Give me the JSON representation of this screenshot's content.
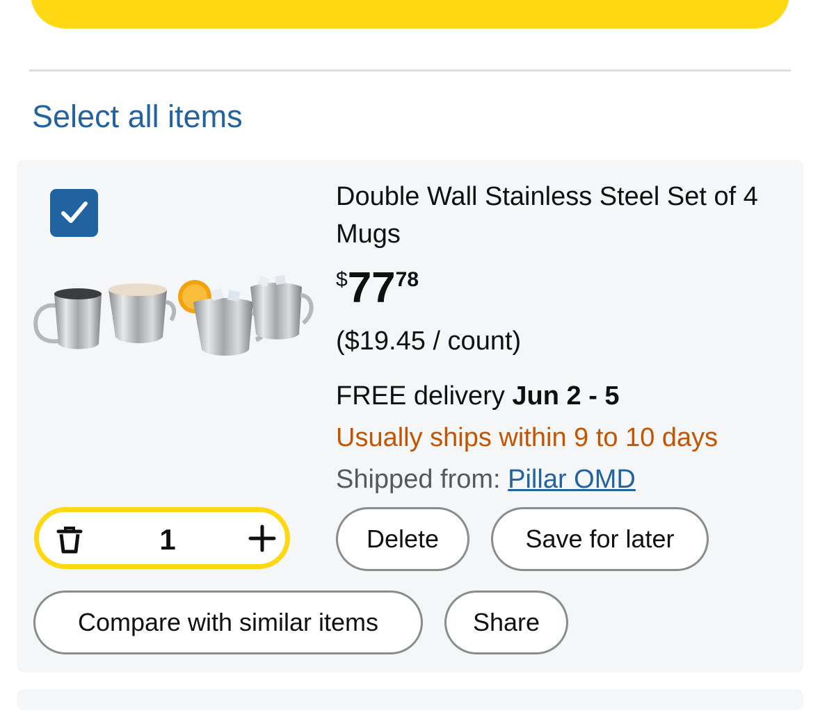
{
  "header": {
    "select_all_label": "Select all items"
  },
  "item": {
    "selected": true,
    "title": "Double Wall Stainless Steel Set of 4 Mugs",
    "price": {
      "currency": "$",
      "whole": "77",
      "fraction": "78"
    },
    "unit_price": "($19.45 / count)",
    "delivery": {
      "prefix": "FREE delivery ",
      "date": "Jun 2 - 5"
    },
    "shipping_note": "Usually ships within 9 to 10 days",
    "shipped_from": {
      "label": "Shipped from: ",
      "seller": "Pillar OMD"
    },
    "quantity": "1",
    "buttons": {
      "delete": "Delete",
      "save_for_later": "Save for later",
      "compare": "Compare with similar items",
      "share": "Share"
    }
  },
  "icons": {
    "checkbox": "checkmark-icon",
    "quantity_remove": "trash-icon",
    "quantity_add": "plus-icon"
  },
  "colors": {
    "primary_button": "#ffd814",
    "link": "#2162a1",
    "shipping_note": "#c45500",
    "card_background": "#f5f6f7",
    "checkbox": "#2162a1"
  }
}
